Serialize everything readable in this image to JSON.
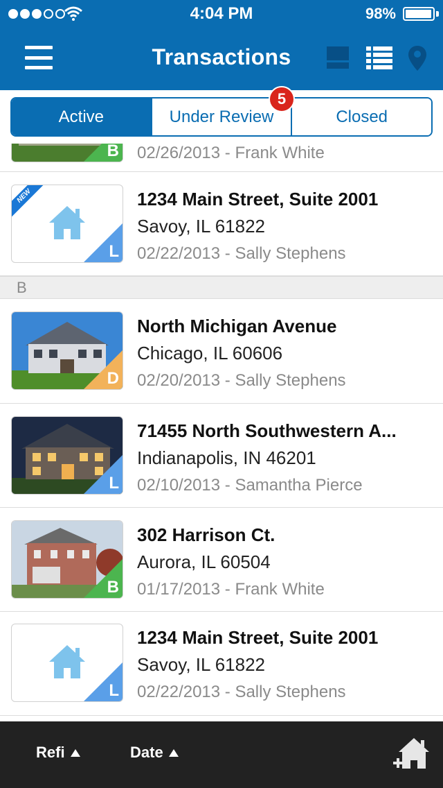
{
  "status_bar": {
    "time": "4:04 PM",
    "battery": "98%",
    "battery_level": 0.98,
    "signal_bars_filled": 3,
    "signal_bars_total": 5
  },
  "nav": {
    "title": "Transactions",
    "icons": [
      "menu-icon",
      "grid-view-icon",
      "list-view-icon",
      "map-pin-icon"
    ]
  },
  "segments": {
    "active": "Active",
    "under_review": "Under Review",
    "closed": "Closed",
    "selected": "Active",
    "under_review_badge": "5"
  },
  "colors": {
    "brand": "#0a6db2",
    "badge": "#d9251c",
    "tag_L": "#5a9fe8",
    "tag_B": "#4cb54f",
    "tag_D": "#f2b25a",
    "toolbar": "#222222"
  },
  "list": {
    "partial_row": {
      "meta": "02/26/2013 - Frank White",
      "tag": "B"
    },
    "row_1": {
      "address": "1234 Main Street, Suite 2001",
      "city": "Savoy, IL 61822",
      "meta": "02/22/2013 - Sally Stephens",
      "tag": "L",
      "badge": "NEW"
    },
    "section_b": "B",
    "row_2": {
      "address": "North Michigan Avenue",
      "city": "Chicago, IL 60606",
      "meta": "02/20/2013 - Sally Stephens",
      "tag": "D"
    },
    "row_3": {
      "address": "71455 North Southwestern A...",
      "city": "Indianapolis, IN 46201",
      "meta": "02/10/2013 - Samantha Pierce",
      "tag": "L"
    },
    "row_4": {
      "address": "302 Harrison Ct.",
      "city": "Aurora, IL 60504",
      "meta": "01/17/2013 - Frank White",
      "tag": "B"
    },
    "row_5": {
      "address": "1234 Main Street, Suite 2001",
      "city": "Savoy, IL 61822",
      "meta": "02/22/2013 - Sally Stephens",
      "tag": "L"
    }
  },
  "toolbar": {
    "sort_refi": "Refi",
    "sort_date": "Date",
    "add_icon": "add-home-icon"
  }
}
